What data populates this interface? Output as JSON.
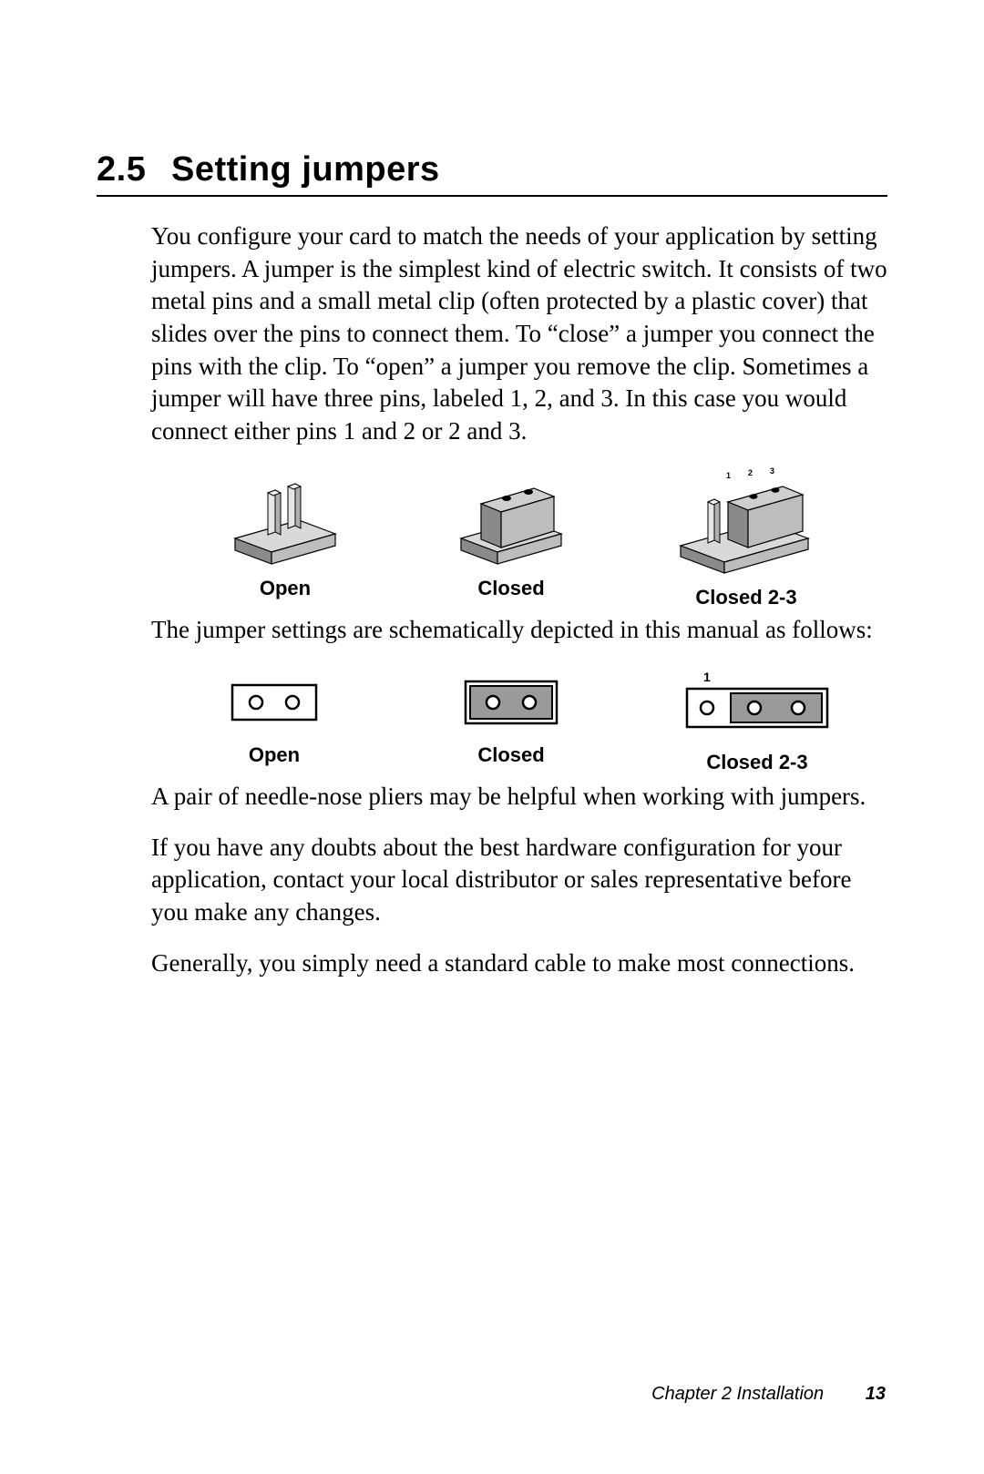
{
  "heading": {
    "number": "2.5",
    "title": "Setting jumpers"
  },
  "paragraphs": {
    "p1": "You configure your card to match the needs of your application by setting jumpers. A jumper is the simplest kind of electric switch. It consists of two metal pins and a small metal clip (often protected by a plastic cover) that slides over the pins to connect them. To “close” a jumper you connect the pins with the clip. To “open” a jumper you remove the clip. Sometimes a jumper will have three pins, labeled 1, 2, and 3. In this case you would connect either pins 1 and 2 or 2 and 3.",
    "p2": "The jumper settings are schematically depicted in this manual as follows:",
    "p3": "A pair of needle-nose pliers may be helpful when working with jumpers.",
    "p4": "If you have any doubts about the best hardware configuration for your application, contact your local distributor or sales representative before you make any changes.",
    "p5": "Generally, you simply need a standard cable to make most connections."
  },
  "figure1": {
    "labels": {
      "open": "Open",
      "closed": "Closed",
      "closed23": "Closed 2-3"
    },
    "pin_numbers": {
      "n1": "1",
      "n2": "2",
      "n3": "3"
    }
  },
  "figure2": {
    "labels": {
      "open": "Open",
      "closed": "Closed",
      "closed23": "Closed 2-3"
    },
    "pin_number": "1"
  },
  "footer": {
    "chapter": "Chapter 2  Installation",
    "page": "13"
  }
}
